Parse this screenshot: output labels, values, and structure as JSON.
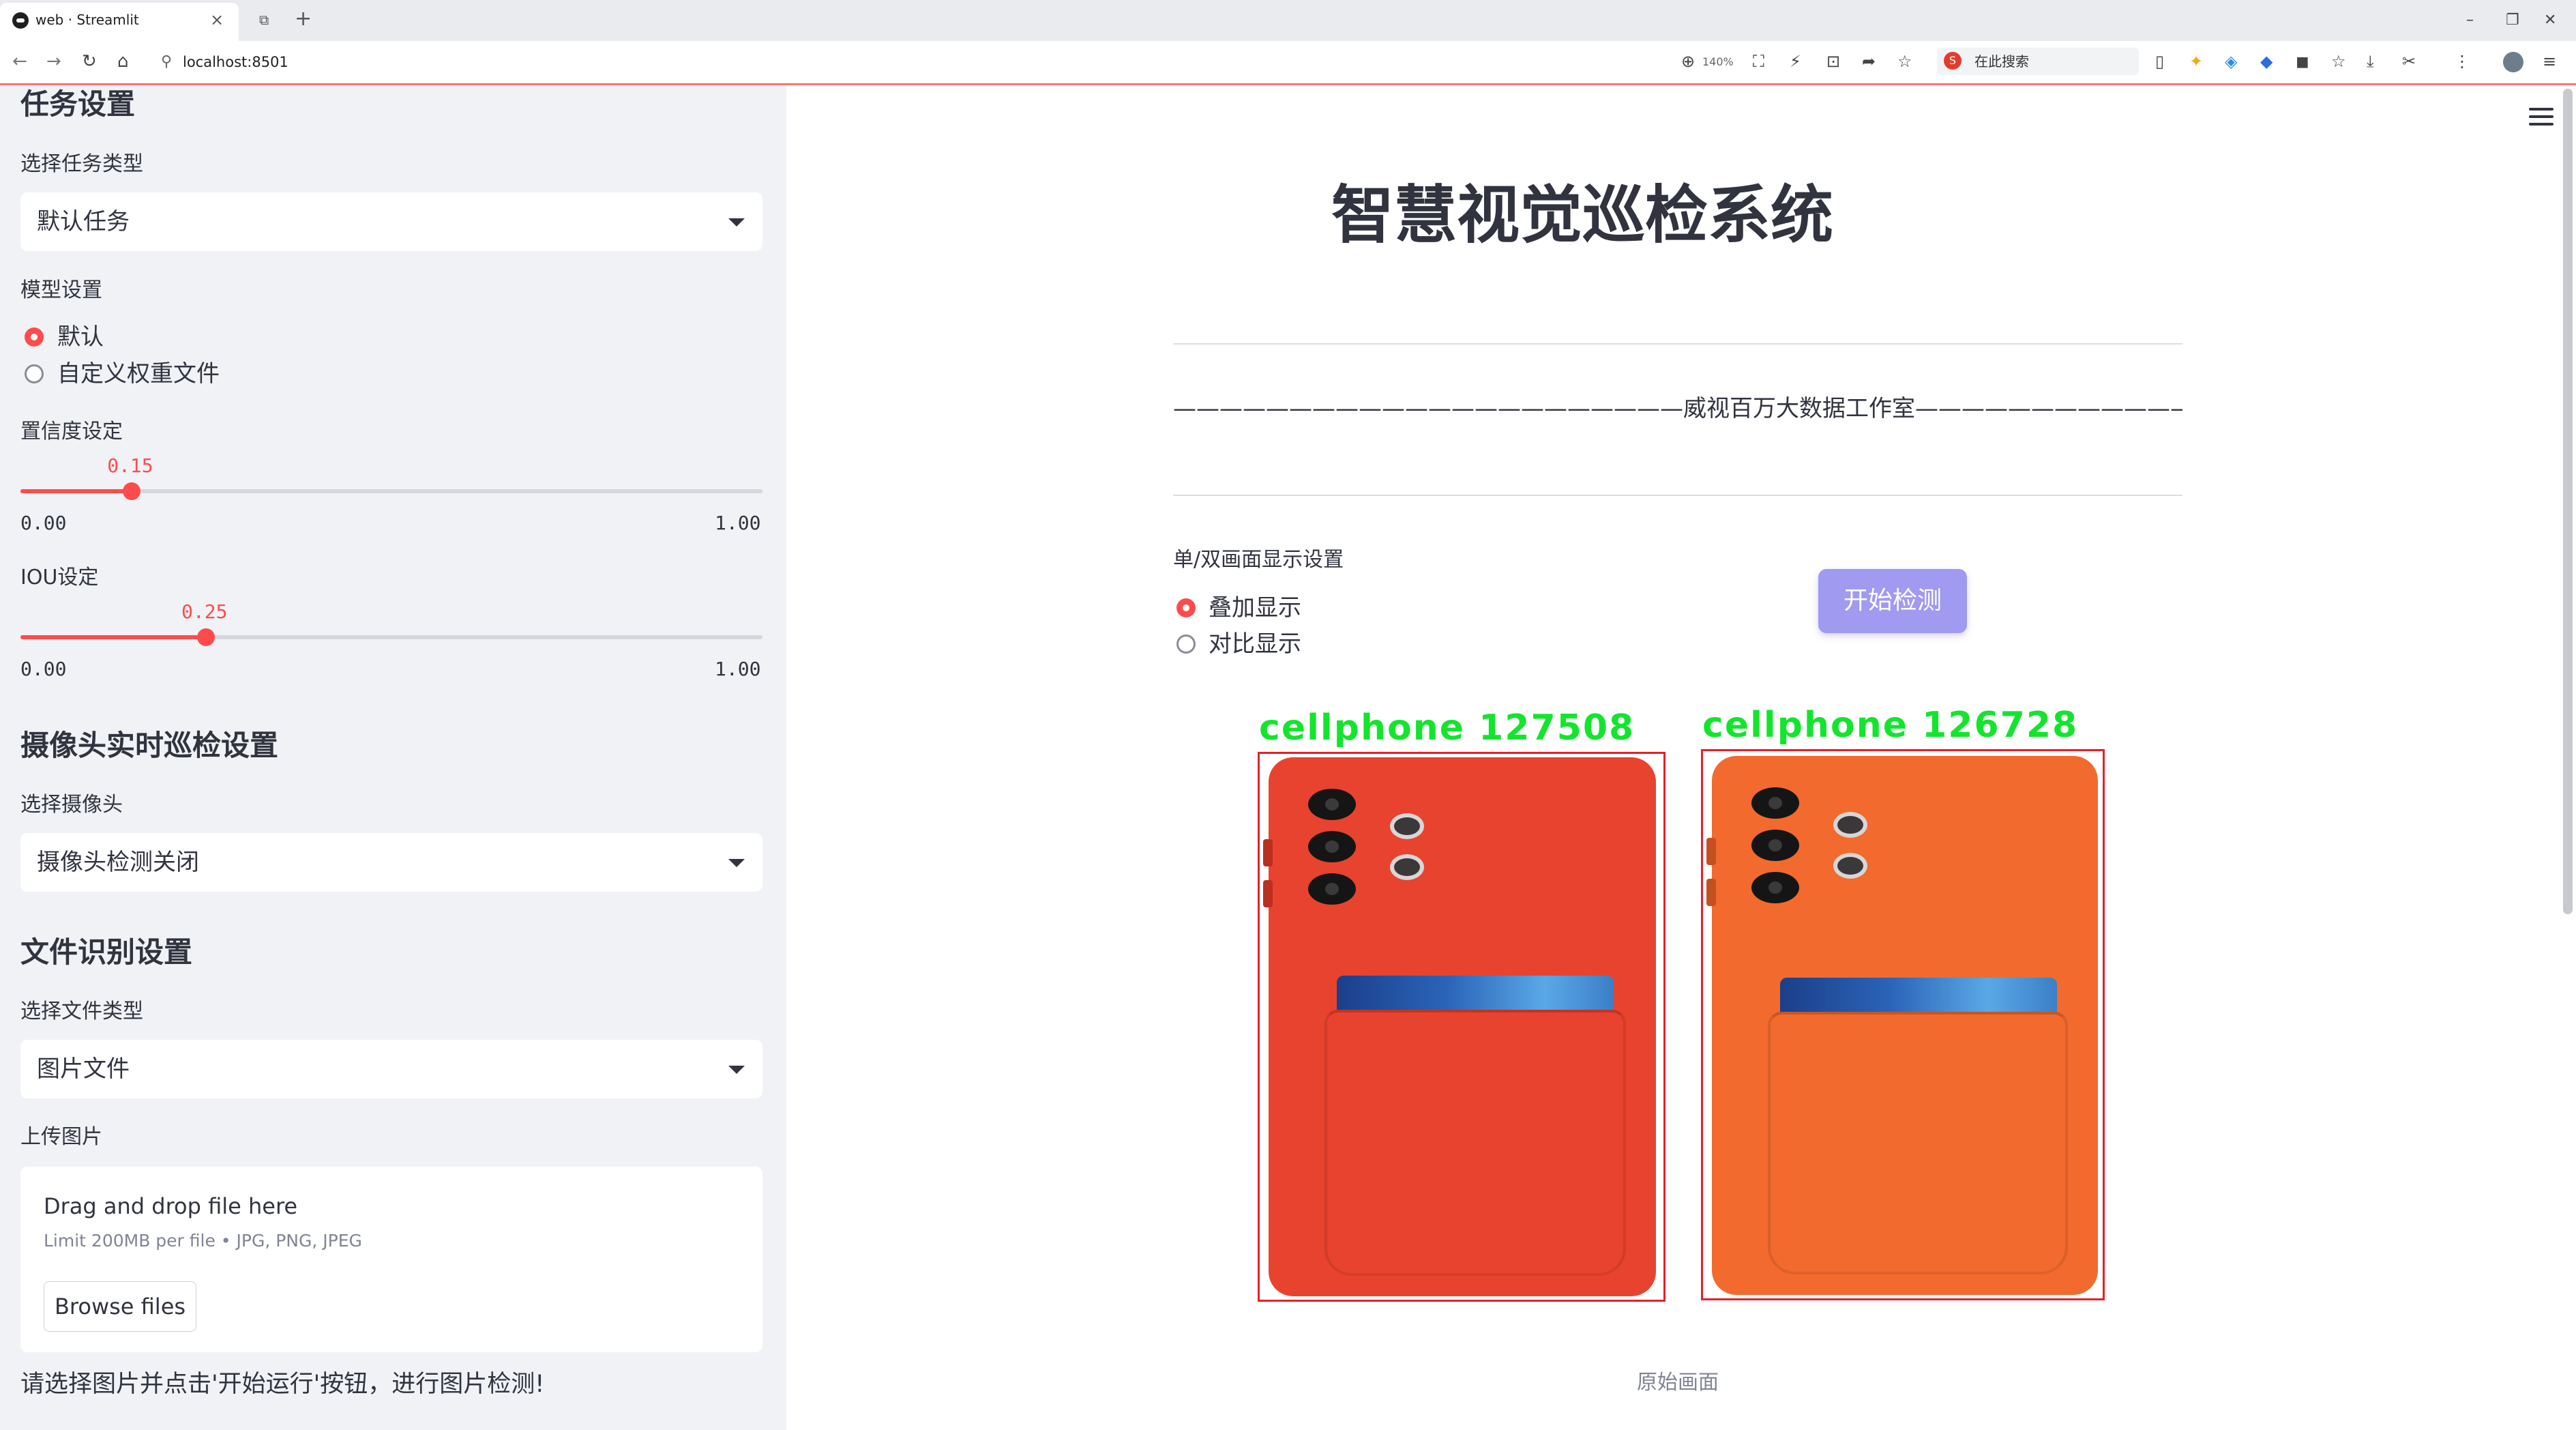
{
  "browser": {
    "tab_title": "web · Streamlit",
    "url": "localhost:8501",
    "zoom": "140%",
    "search_placeholder": "在此搜索",
    "search_engine_glyph": "S"
  },
  "sidebar": {
    "task_section_title": "任务设置",
    "task_type_label": "选择任务类型",
    "task_type_value": "默认任务",
    "model_label": "模型设置",
    "model_options": [
      "默认",
      "自定义权重文件"
    ],
    "model_selected": 0,
    "conf_label": "置信度设定",
    "conf_value": "0.15",
    "conf_level": 0.15,
    "conf_min": "0.00",
    "conf_max": "1.00",
    "iou_label": "IOU设定",
    "iou_value": "0.25",
    "iou_level": 0.25,
    "iou_min": "0.00",
    "iou_max": "1.00",
    "camera_section_title": "摄像头实时巡检设置",
    "camera_label": "选择摄像头",
    "camera_value": "摄像头检测关闭",
    "file_section_title": "文件识别设置",
    "file_type_label": "选择文件类型",
    "file_type_value": "图片文件",
    "upload_label": "上传图片",
    "upload_drag_text": "Drag and drop file here",
    "upload_limit_text": "Limit 200MB per file • JPG, PNG, JPEG",
    "browse_button": "Browse files",
    "tip": "请选择图片并点击'开始运行'按钮，进行图片检测!"
  },
  "main": {
    "title": "智慧视觉巡检系统",
    "studio_line": "——————————————————————威视百万大数据工作室———————————————————————",
    "display_mode_label": "单/双画面显示设置",
    "display_options": [
      "叠加显示",
      "对比显示"
    ],
    "display_selected": 0,
    "start_button": "开始检测",
    "detections": [
      {
        "label": "cellphone",
        "id": "127508",
        "color": "#e8432e"
      },
      {
        "label": "cellphone",
        "id": "126728",
        "color": "#f26a2e"
      }
    ],
    "caption": "原始画面"
  },
  "colors": {
    "accent": "#ff4b4b",
    "sidebar_bg": "#f0f2f6",
    "button_bg": "#a09af0",
    "det_label": "#13e52d",
    "det_box": "#e5202a"
  }
}
